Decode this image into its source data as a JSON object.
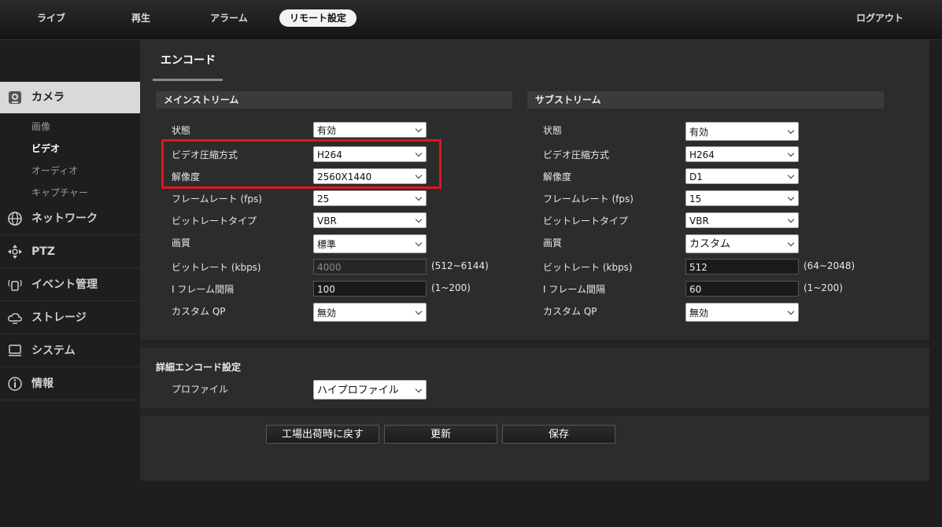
{
  "nav": {
    "items": [
      {
        "label": "ライブ"
      },
      {
        "label": "再生"
      },
      {
        "label": "アラーム"
      },
      {
        "label": "リモート設定"
      }
    ],
    "logout": "ログアウト"
  },
  "sidebar": {
    "camera": "カメラ",
    "sub": [
      "画像",
      "ビデオ",
      "オーディオ",
      "キャプチャー"
    ],
    "network": "ネットワーク",
    "ptz": "PTZ",
    "event": "イベント管理",
    "storage": "ストレージ",
    "system": "システム",
    "info": "情報"
  },
  "tab": "エンコード",
  "main": {
    "title": "メインストリーム",
    "labels": [
      "状態",
      "ビデオ圧縮方式",
      "解像度",
      "フレームレート (fps)",
      "ビットレートタイプ",
      "画質",
      "ビットレート (kbps)",
      "I フレーム間隔",
      "カスタム QP"
    ],
    "state": "有効",
    "codec": "H264",
    "resolution": "2560X1440",
    "fps": "25",
    "bitrate_type": "VBR",
    "quality": "標準",
    "bitrate": "4000",
    "bitrate_range": "(512~6144)",
    "iframe": "100",
    "iframe_range": "(1~200)",
    "custom_qp": "無効"
  },
  "sub": {
    "title": "サブストリーム",
    "labels": [
      "状態",
      "ビデオ圧縮方式",
      "解像度",
      "フレームレート (fps)",
      "ビットレートタイプ",
      "画質",
      "ビットレート (kbps)",
      "I フレーム間隔",
      "カスタム QP"
    ],
    "state": "有効",
    "codec": "H264",
    "resolution": "D1",
    "fps": "15",
    "bitrate_type": "VBR",
    "quality": "カスタム",
    "bitrate": "512",
    "bitrate_range": "(64~2048)",
    "iframe": "60",
    "iframe_range": "(1~200)",
    "custom_qp": "無効"
  },
  "advanced": {
    "title": "詳細エンコード設定",
    "profile_label": "プロファイル",
    "profile": "ハイプロファイル"
  },
  "buttons": {
    "factory": "工場出荷時に戻す",
    "refresh": "更新",
    "save": "保存"
  },
  "colors": {
    "highlight": "#e0151c",
    "active_nav": "#f3f3f3"
  }
}
